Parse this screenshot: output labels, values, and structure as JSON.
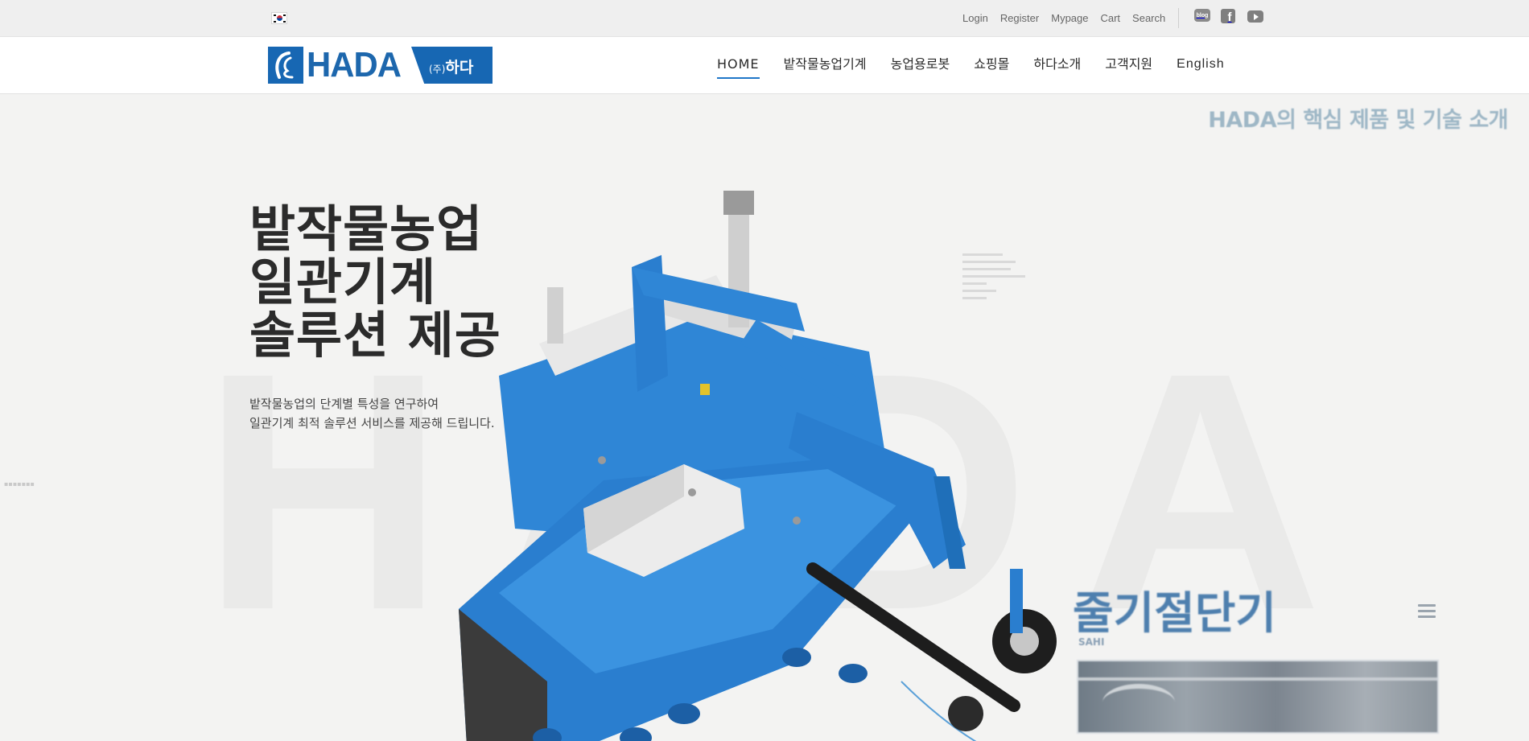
{
  "topbar": {
    "links": [
      "Login",
      "Register",
      "Mypage",
      "Cart",
      "Search"
    ],
    "social": {
      "blog_label": "blog"
    }
  },
  "header": {
    "logo": {
      "wordmark": "HADA",
      "ko_prefix": "(주)",
      "ko_name": "하다"
    },
    "nav": [
      "HOME",
      "밭작물농업기계",
      "농업용로봇",
      "쇼핑몰",
      "하다소개",
      "고객지원",
      "English"
    ],
    "active_nav": "HOME"
  },
  "hero": {
    "bg_letters": "HADA",
    "title_lines": [
      "밭작물농업",
      "일관기계",
      "솔루션 제공"
    ],
    "desc_lines": [
      "밭작물농업의 단계별 특성을 연구하여",
      "일관기계 최적 솔루션 서비스를 제공해 드립니다."
    ],
    "tagline": "HADA의 핵심 제품 및 기술 소개",
    "product_name": "줄기절단기",
    "product_sub": "SAHI"
  },
  "colors": {
    "brand_blue": "#1767b3",
    "nav_underline": "#1f76c8",
    "machine_blue": "#2f86d6"
  }
}
